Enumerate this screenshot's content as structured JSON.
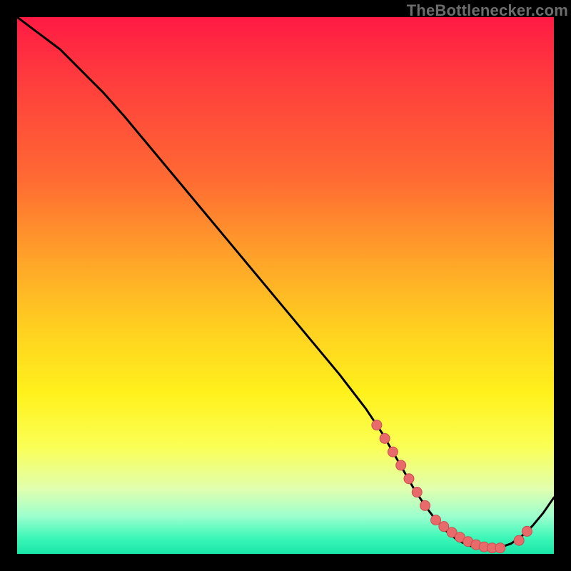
{
  "watermark": "TheBottlenecker.com",
  "colors": {
    "curve": "#000000",
    "dot_fill": "#e86a6a",
    "dot_stroke": "#c94f4f",
    "gradient_top": "#ff1a44",
    "gradient_bottom": "#18e6a8"
  },
  "chart_data": {
    "type": "line",
    "title": "",
    "xlabel": "",
    "ylabel": "",
    "xlim": [
      0,
      100
    ],
    "ylim": [
      0,
      100
    ],
    "grid": false,
    "legend": false,
    "series": [
      {
        "name": "bottleneck-curve",
        "x": [
          0,
          4,
          8,
          12,
          16,
          20,
          25,
          30,
          35,
          40,
          45,
          50,
          55,
          60,
          65,
          68,
          70,
          72,
          74,
          76,
          78,
          80,
          82,
          84,
          86,
          88,
          90,
          92,
          94,
          96,
          98,
          100
        ],
        "y": [
          100,
          97,
          94,
          90,
          86,
          81.5,
          75.5,
          69.5,
          63.5,
          57.5,
          51.5,
          45.5,
          39.5,
          33.5,
          27,
          22.5,
          19,
          15.5,
          12,
          9,
          6.3,
          4.2,
          2.6,
          1.6,
          1.1,
          1.0,
          1.2,
          1.9,
          3.3,
          5.2,
          7.6,
          10.5
        ]
      }
    ],
    "highlight_points": {
      "comment": "salmon dots along the valley region of the curve",
      "x": [
        67,
        68.5,
        70,
        71.5,
        73,
        74.5,
        76,
        78,
        79.5,
        81,
        82.5,
        84,
        85.5,
        87,
        88.5,
        90,
        93.5,
        95
      ],
      "y": [
        24,
        21.5,
        19,
        16.5,
        14,
        11.5,
        9,
        6.3,
        5.1,
        4.0,
        3.1,
        2.3,
        1.7,
        1.3,
        1.1,
        1.1,
        2.5,
        4.2
      ],
      "r": 7
    }
  }
}
